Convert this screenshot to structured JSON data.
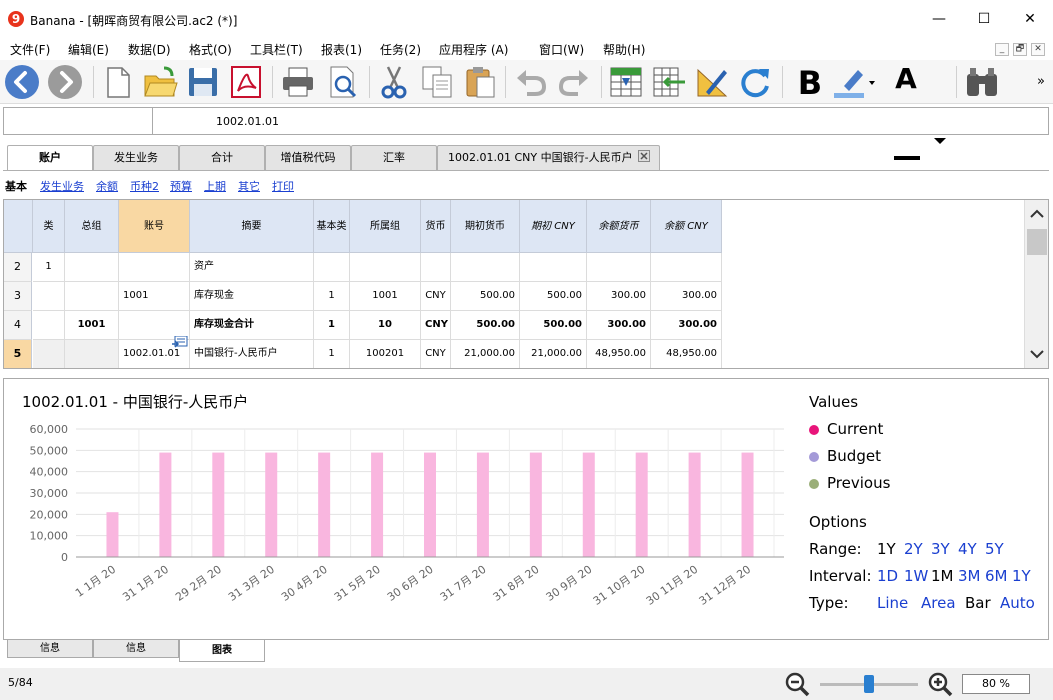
{
  "window": {
    "app": "Banana",
    "title": "Banana - [朝晖商贸有限公司.ac2 (*)]",
    "minimize": "—",
    "maximize": "☐",
    "close": "✕"
  },
  "menu": [
    "文件(F)",
    "编辑(E)",
    "数据(D)",
    "格式(O)",
    "工具栏(T)",
    "报表(1)",
    "任务(2)",
    "应用程序  (A)",
    "窗口(W)",
    "帮助(H)"
  ],
  "mdi": [
    "_",
    "🗗",
    "✕"
  ],
  "toolbar": {
    "overflow": "»",
    "bold": "B",
    "font_color": "A"
  },
  "address": {
    "value": "1002.01.01"
  },
  "tabs": [
    "账户",
    "发生业务",
    "合计",
    "增值税代码",
    "汇率",
    "1002.01.01 CNY 中国银行-人民币户"
  ],
  "views": [
    "基本",
    "发生业务",
    "余额",
    "币种2",
    "预算",
    "上期",
    "其它",
    "打印"
  ],
  "grid": {
    "headers": [
      "类",
      "总组",
      "账号",
      "摘要",
      "基本类",
      "所属组",
      "货币",
      "期初货币",
      "期初 CNY",
      "余额货币",
      "余额 CNY"
    ],
    "rows": [
      {
        "num": "2",
        "cells": [
          "1",
          "",
          "",
          "资产",
          "",
          "",
          "",
          "",
          "",
          "",
          ""
        ]
      },
      {
        "num": "3",
        "cells": [
          "",
          "",
          "1001",
          "库存现金",
          "1",
          "1001",
          "CNY",
          "500.00",
          "500.00",
          "300.00",
          "300.00"
        ]
      },
      {
        "num": "4",
        "cells": [
          "",
          "1001",
          "",
          "库存现金合计",
          "1",
          "10",
          "CNY",
          "500.00",
          "500.00",
          "300.00",
          "300.00"
        ]
      },
      {
        "num": "5",
        "cells": [
          "",
          "",
          "1002.01.01",
          "中国银行-人民币户",
          "1",
          "100201",
          "CNY",
          "21,000.00",
          "21,000.00",
          "48,950.00",
          "48,950.00"
        ]
      }
    ]
  },
  "chart_panel": {
    "title": "1002.01.01 - 中国银行-人民币户"
  },
  "chart_data": {
    "type": "bar",
    "categories": [
      "1 1月 20",
      "31 1月 20",
      "29 2月 20",
      "31 3月 20",
      "30 4月 20",
      "31 5月 20",
      "30 6月 20",
      "31 7月 20",
      "31 8月 20",
      "30 9月 20",
      "31 10月 20",
      "30 11月 20",
      "31 12月 20"
    ],
    "series": [
      {
        "name": "Current",
        "color": "#f9b6df",
        "values": [
          21000,
          48950,
          48950,
          48950,
          48950,
          48950,
          48950,
          48950,
          48950,
          48950,
          48950,
          48950,
          48950
        ]
      }
    ],
    "yticks": [
      "0",
      "10,000",
      "20,000",
      "30,000",
      "40,000",
      "50,000",
      "60,000"
    ],
    "ylim": [
      0,
      60000
    ],
    "grid": true,
    "legend": "right"
  },
  "legend": {
    "values_title": "Values",
    "items": [
      {
        "label": "Current",
        "color": "#e8147a"
      },
      {
        "label": "Budget",
        "color": "#a49ad8"
      },
      {
        "label": "Previous",
        "color": "#9aae78"
      }
    ],
    "options_title": "Options",
    "range_label": "Range:",
    "range": [
      "1Y",
      "2Y",
      "3Y",
      "4Y",
      "5Y"
    ],
    "range_sel": "1Y",
    "interval_label": "Interval:",
    "interval": [
      "1D",
      "1W",
      "1M",
      "3M",
      "6M",
      "1Y"
    ],
    "interval_sel": "1M",
    "type_label": "Type:",
    "types": [
      "Line",
      "Area",
      "Bar",
      "Auto"
    ],
    "type_sel": "Bar"
  },
  "bottom_tabs": [
    "信息",
    "信息",
    "图表"
  ],
  "status": {
    "position": "5/84",
    "zoom": "80  %",
    "zoom_level": 0.5
  }
}
